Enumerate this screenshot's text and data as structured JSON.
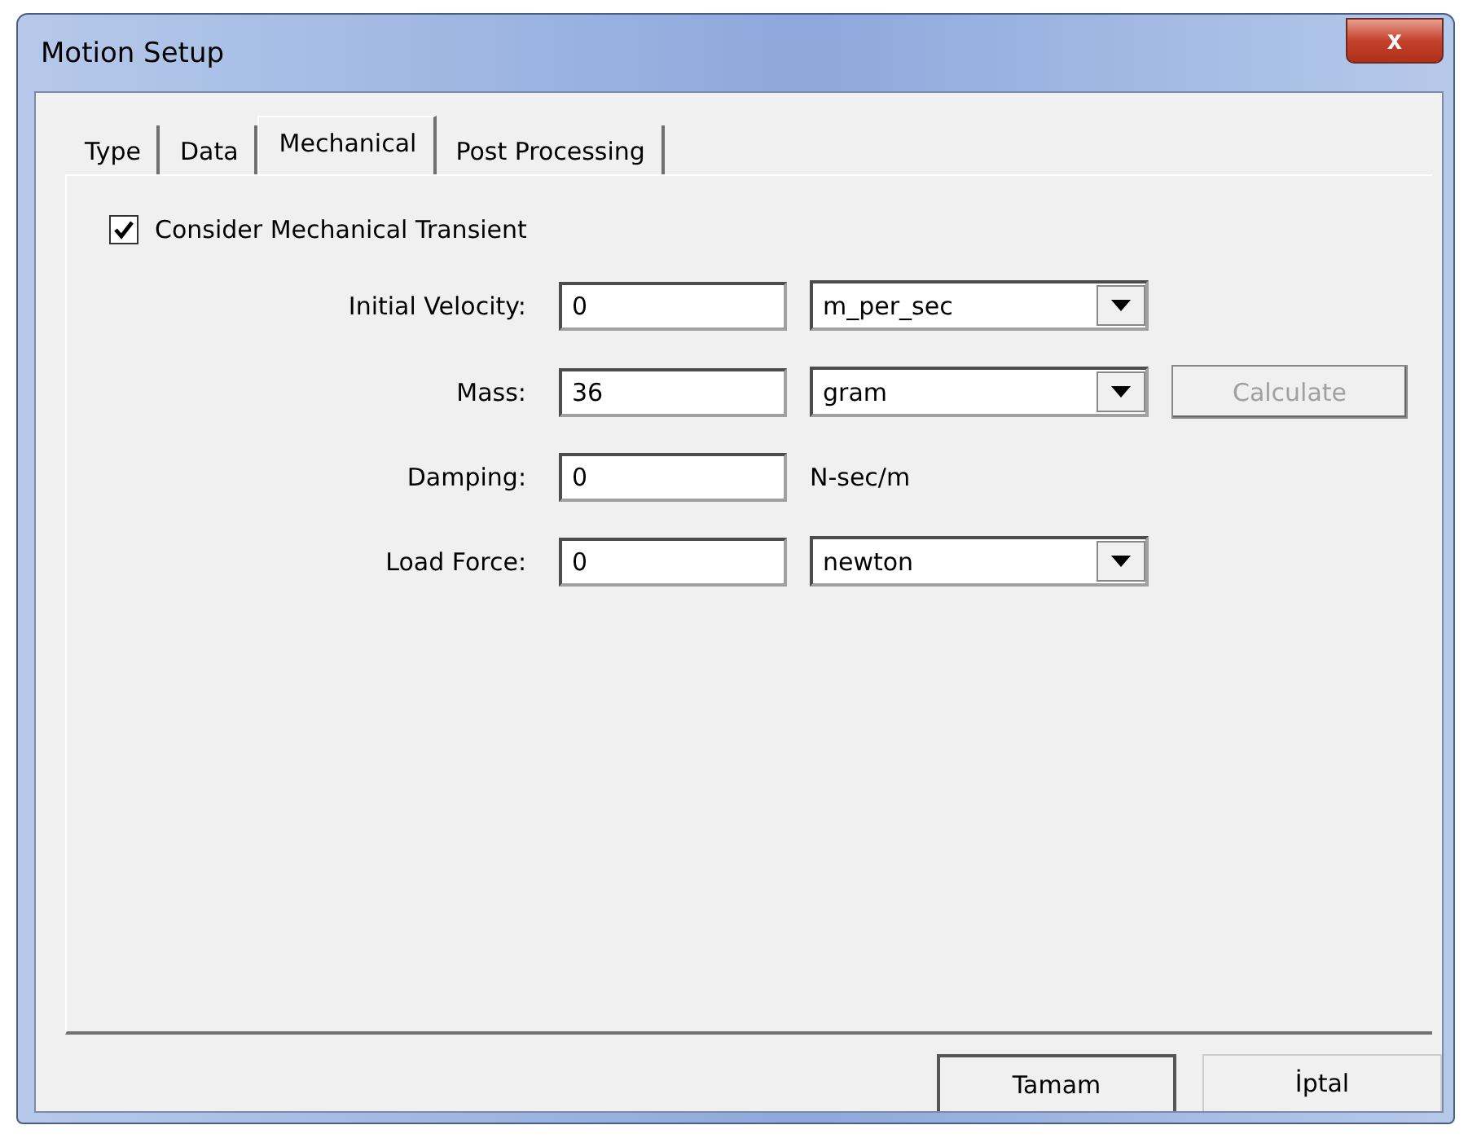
{
  "window": {
    "title": "Motion Setup",
    "close": "x"
  },
  "tabs": [
    {
      "label": "Type",
      "selected": false
    },
    {
      "label": "Data",
      "selected": false
    },
    {
      "label": "Mechanical",
      "selected": true
    },
    {
      "label": "Post Processing",
      "selected": false
    }
  ],
  "consider": {
    "label": "Consider Mechanical Transient",
    "checked": true
  },
  "rows": [
    {
      "label": "Initial Velocity:",
      "value": "0",
      "kind": "combo",
      "unit": "m_per_sec"
    },
    {
      "label": "Mass:",
      "value": "36",
      "kind": "combo",
      "unit": "gram",
      "action": {
        "label": "Calculate",
        "disabled": true
      }
    },
    {
      "label": "Damping:",
      "value": "0",
      "kind": "text",
      "unit": "N-sec/m"
    },
    {
      "label": "Load Force:",
      "value": "0",
      "kind": "combo",
      "unit": "newton"
    }
  ],
  "buttons": [
    {
      "label": "Tamam",
      "default": true
    },
    {
      "label": "İptal",
      "default": false
    }
  ]
}
